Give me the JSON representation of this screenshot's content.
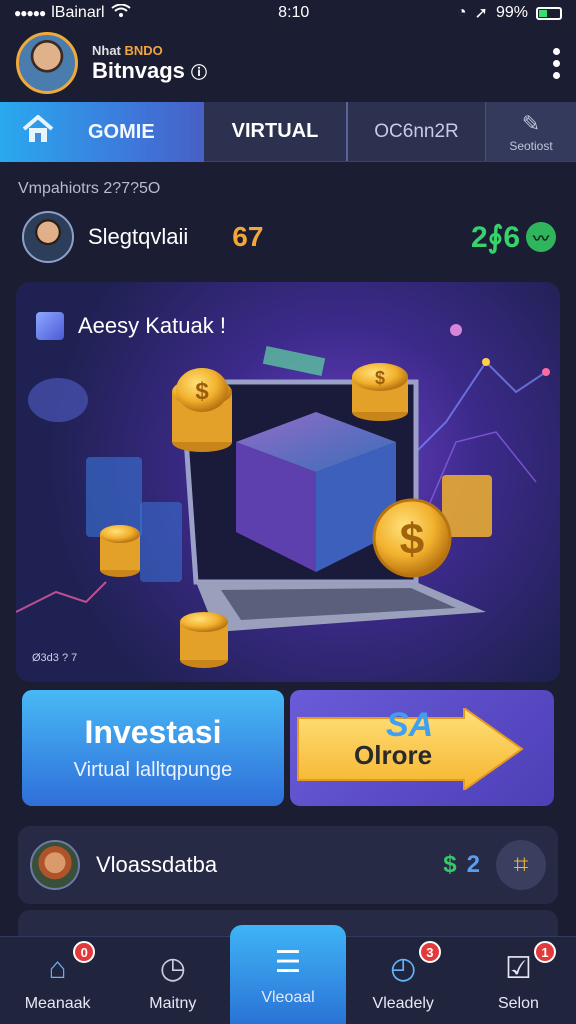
{
  "status_bar": {
    "carrier": "lBainarl",
    "time": "8:10",
    "battery": "99%"
  },
  "header": {
    "subtitle_prefix": "Nhat",
    "subtitle_accent": "BNDO",
    "title": "Bitnvags"
  },
  "tabs": [
    {
      "label": "GOMIE"
    },
    {
      "label": "VIRTUAL"
    },
    {
      "label": "OC6nn2R"
    },
    {
      "label": "Seotiost"
    }
  ],
  "summary": {
    "recent_label": "Vmpahiotrs 2?7?5O",
    "user_name": "Slegtqvlaii",
    "number": "67",
    "score": "2∮6"
  },
  "hero": {
    "heading": "Aeesy Katuak !",
    "footer": "Ø3d3 ? 7"
  },
  "cta": {
    "left_title": "Investasi",
    "left_subtitle": "Virtual lalltqpunge",
    "right_badge": "SA",
    "right_label": "Olrore"
  },
  "activity": {
    "name": "Vloassdatba",
    "currency": "$",
    "amount": "2"
  },
  "nav": [
    {
      "label": "Meanaak",
      "icon": "home-icon",
      "badge": "0"
    },
    {
      "label": "Maitny",
      "icon": "gauge-icon"
    },
    {
      "label": "Vleoaal",
      "icon": "ticket-icon"
    },
    {
      "label": "Vleadely",
      "icon": "clock-icon",
      "badge": "3"
    },
    {
      "label": "Selon",
      "icon": "checklist-icon",
      "badge": "1"
    }
  ],
  "colors": {
    "accent": "#2fa6ef",
    "gold": "#f2a73b",
    "green": "#37d26b",
    "background": "#1b1d33"
  }
}
